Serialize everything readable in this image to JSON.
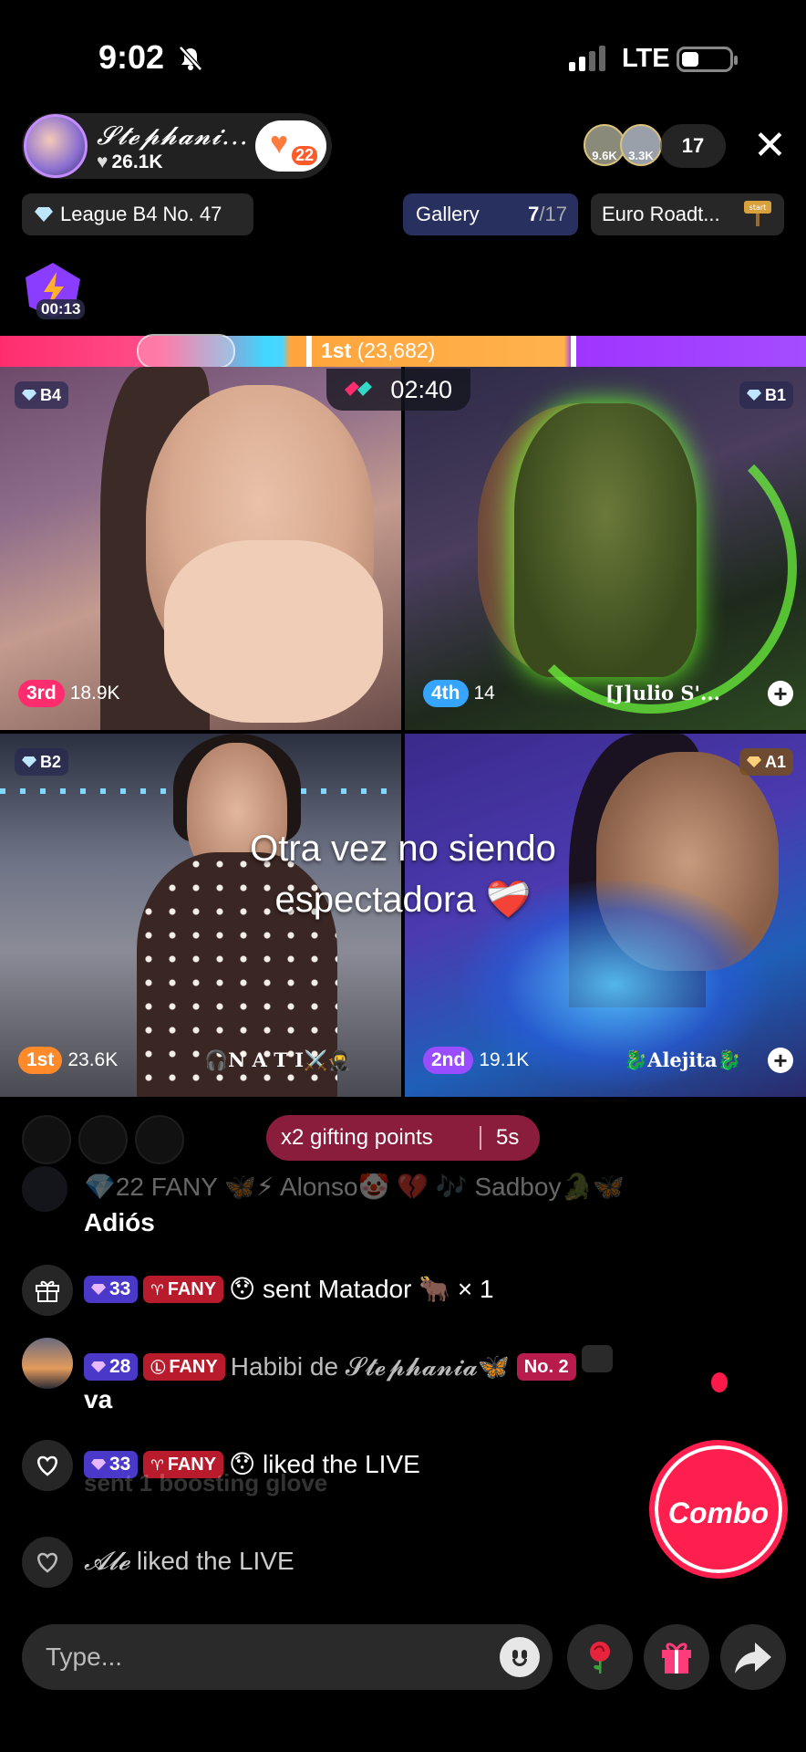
{
  "status": {
    "time": "9:02",
    "network": "LTE"
  },
  "host": {
    "name": "𝓢𝓽𝓮𝓹𝓱𝓪𝓷𝓲...",
    "likes": "26.1K",
    "follow_count": "22"
  },
  "viewers": {
    "avatar_1_score": "9.6K",
    "avatar_2_score": "3.3K",
    "count": "17"
  },
  "pills": {
    "league": "League B4 No. 47",
    "gallery_label": "Gallery",
    "gallery_current": "7",
    "gallery_total": "/17",
    "event": "Euro Roadt..."
  },
  "boost": {
    "timer": "00:13"
  },
  "battle": {
    "leader_label": "1st",
    "leader_score": "(23,682)",
    "timer": "02:40"
  },
  "tiles": [
    {
      "tier": "B4",
      "rank": "3rd",
      "score": "18.9K",
      "name": ""
    },
    {
      "tier": "B1",
      "rank": "4th",
      "score": "14",
      "name": "[J]ulio S'..."
    },
    {
      "tier": "B2",
      "rank": "1st",
      "score": "23.6K",
      "name": "🎧N A T I⚔️🥷"
    },
    {
      "tier": "A1",
      "rank": "2nd",
      "score": "19.1K",
      "name": "🐉Alejita🐉"
    }
  ],
  "caption": {
    "line1": "Otra vez no siendo",
    "line2": "espectadora ❤️‍🩹"
  },
  "gift_points": {
    "label": "x2 gifting points",
    "time": "5s"
  },
  "chat": {
    "faded_row": "💎22  FANY  🦋⚡ Alonso🤡 💔 🎶 Sadboy🐊🦋",
    "bye": "Adiós",
    "gift_row": {
      "level": "33",
      "fan": "FANY",
      "emoji": "😯",
      "text": "sent Matador 🐂 × 1"
    },
    "habibi_row": {
      "level": "28",
      "fan": "FANY",
      "name": "Habibi de 𝓢𝓽𝓮𝓹𝓱𝓪𝓷𝓲𝓪🦋",
      "badge": "No. 2",
      "message": "va"
    },
    "like_row": {
      "level": "33",
      "fan": "FANY",
      "emoji": "😯",
      "text": "liked the LIVE"
    },
    "boost_ghost": "sent 1 boosting glove",
    "ale_row": {
      "name": "𝓐𝓵𝓮",
      "text": "liked the LIVE"
    }
  },
  "combo": {
    "label": "Combo"
  },
  "input": {
    "placeholder": "Type..."
  }
}
